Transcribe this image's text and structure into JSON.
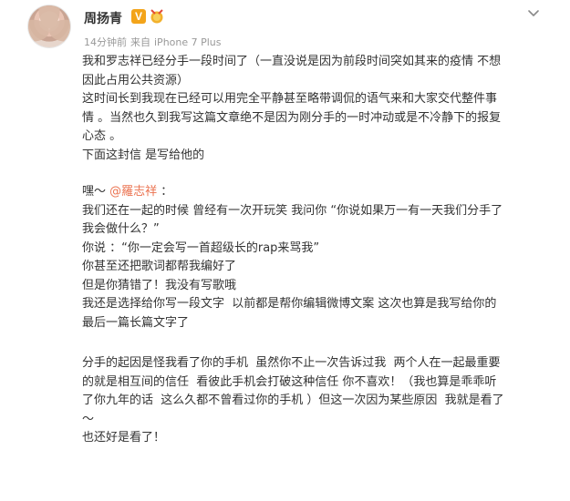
{
  "post": {
    "author": "周扬青",
    "time": "14分钟前",
    "source_prefix": "来自",
    "source": "iPhone 7 Plus",
    "verified_label": "V",
    "colors": {
      "name": "#333333",
      "meta": "#999999",
      "mention": "#eb7350",
      "verified": "#f3a41a"
    },
    "icons": [
      "verified-v-icon",
      "medal-icon",
      "chevron-down-icon"
    ]
  },
  "content": {
    "p1": "我和罗志祥已经分手一段时间了（一直没说是因为前段时间突如其来的疫情 不想\n因此占用公共资源）",
    "p2": "这时间长到我现在已经可以用完全平静甚至略带调侃的语气来和大家交代整件事\n情 。当然也久到我写这篇文章绝不是因为刚分手的一时冲动或是不冷静下的报复\n心态 。",
    "p3": "下面这封信 是写给他的",
    "greeting_prefix": "嘿～ ",
    "mention": "@羅志祥",
    "greeting_suffix": " ：",
    "p4": "我们还在一起的时候 曾经有一次开玩笑 我问你 “你说如果万一有一天我们分手了\n我会做什么？”",
    "p5": "你说 ：“你一定会写一首超级长的rap来骂我”",
    "p6": "你甚至还把歌词都帮我编好了",
    "p7": "但是你猜错了！我没有写歌哦",
    "p8": "我还是选择给你写一段文字  以前都是帮你编辑微博文案 这次也算是我写给你的\n最后一篇长篇文字了",
    "p9": "分手的起因是怪我看了你的手机  虽然你不止一次告诉过我  两个人在一起最重要\n的就是相互间的信任  看彼此手机会打破这种信任 你不喜欢！（我也算是乖乖听\n了你九年的话  这么久都不曾看过你的手机 ）但这一次因为某些原因  我就是看了\n～",
    "p10": "也还好是看了！"
  }
}
